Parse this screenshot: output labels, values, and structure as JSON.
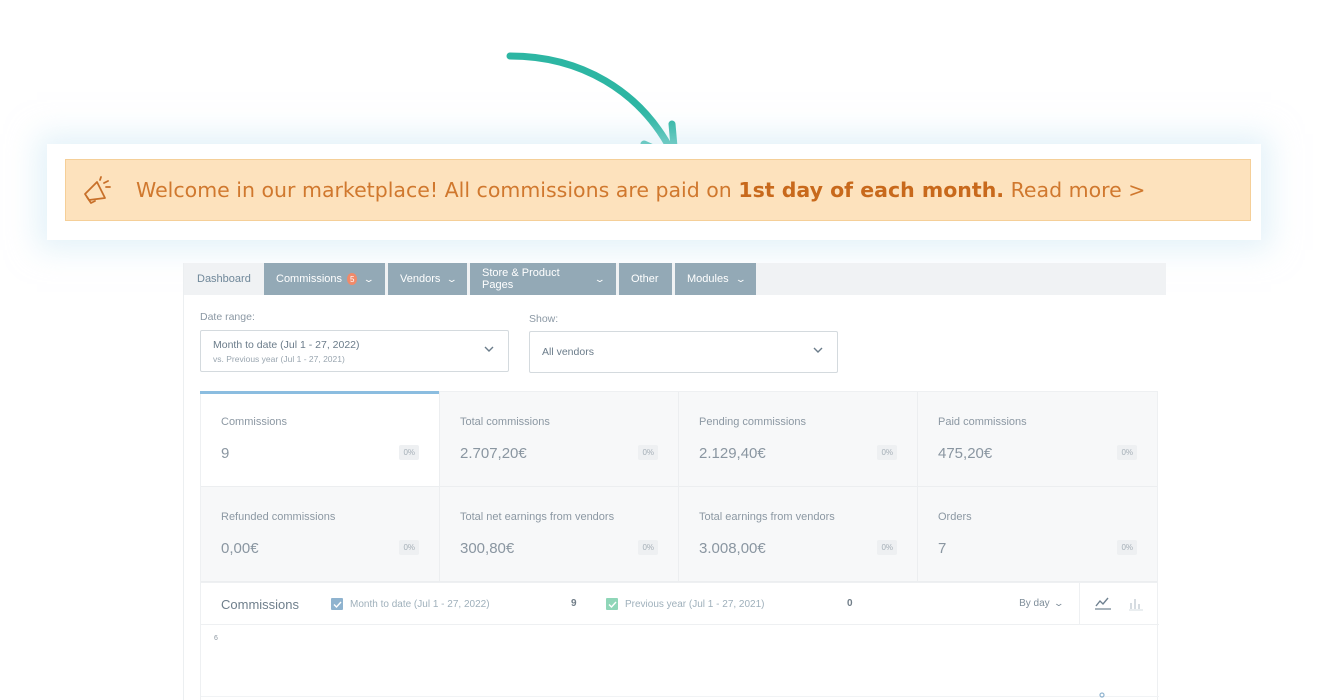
{
  "banner": {
    "text_before": "Welcome in our marketplace! All commissions are paid on ",
    "text_bold": "1st day of each month.",
    "text_link": " Read more >",
    "icon": "megaphone-icon",
    "colors": {
      "background": "#fde2bd",
      "text": "#d0782e"
    }
  },
  "tabs": [
    {
      "label": "Dashboard"
    },
    {
      "label": "Commissions",
      "badge": "5"
    },
    {
      "label": "Vendors"
    },
    {
      "label": "Store & Product Pages"
    },
    {
      "label": "Other"
    },
    {
      "label": "Modules"
    }
  ],
  "filters": {
    "date_range": {
      "label": "Date range:",
      "value": "Month to date (Jul 1 - 27, 2022)",
      "compare": "vs. Previous year (Jul 1 - 27, 2021)"
    },
    "show": {
      "label": "Show:",
      "value": "All vendors"
    }
  },
  "stats": [
    {
      "label": "Commissions",
      "value": "9",
      "delta": "0%"
    },
    {
      "label": "Total commissions",
      "value": "2.707,20€",
      "delta": "0%"
    },
    {
      "label": "Pending commissions",
      "value": "2.129,40€",
      "delta": "0%"
    },
    {
      "label": "Paid commissions",
      "value": "475,20€",
      "delta": "0%"
    },
    {
      "label": "Refunded commissions",
      "value": "0,00€",
      "delta": "0%"
    },
    {
      "label": "Total net earnings from vendors",
      "value": "300,80€",
      "delta": "0%"
    },
    {
      "label": "Total earnings from vendors",
      "value": "3.008,00€",
      "delta": "0%"
    },
    {
      "label": "Orders",
      "value": "7",
      "delta": "0%"
    }
  ],
  "chart": {
    "title": "Commissions",
    "legend_current": "Month to date (Jul 1 - 27, 2022)",
    "legend_current_count": "9",
    "legend_previous": "Previous year (Jul 1 - 27, 2021)",
    "legend_previous_count": "0",
    "interval": "By day",
    "y_tick_top": "6",
    "colors": {
      "current": "#8fb3cf",
      "previous": "#8fd6b8",
      "accent": "#8bbde0"
    }
  }
}
